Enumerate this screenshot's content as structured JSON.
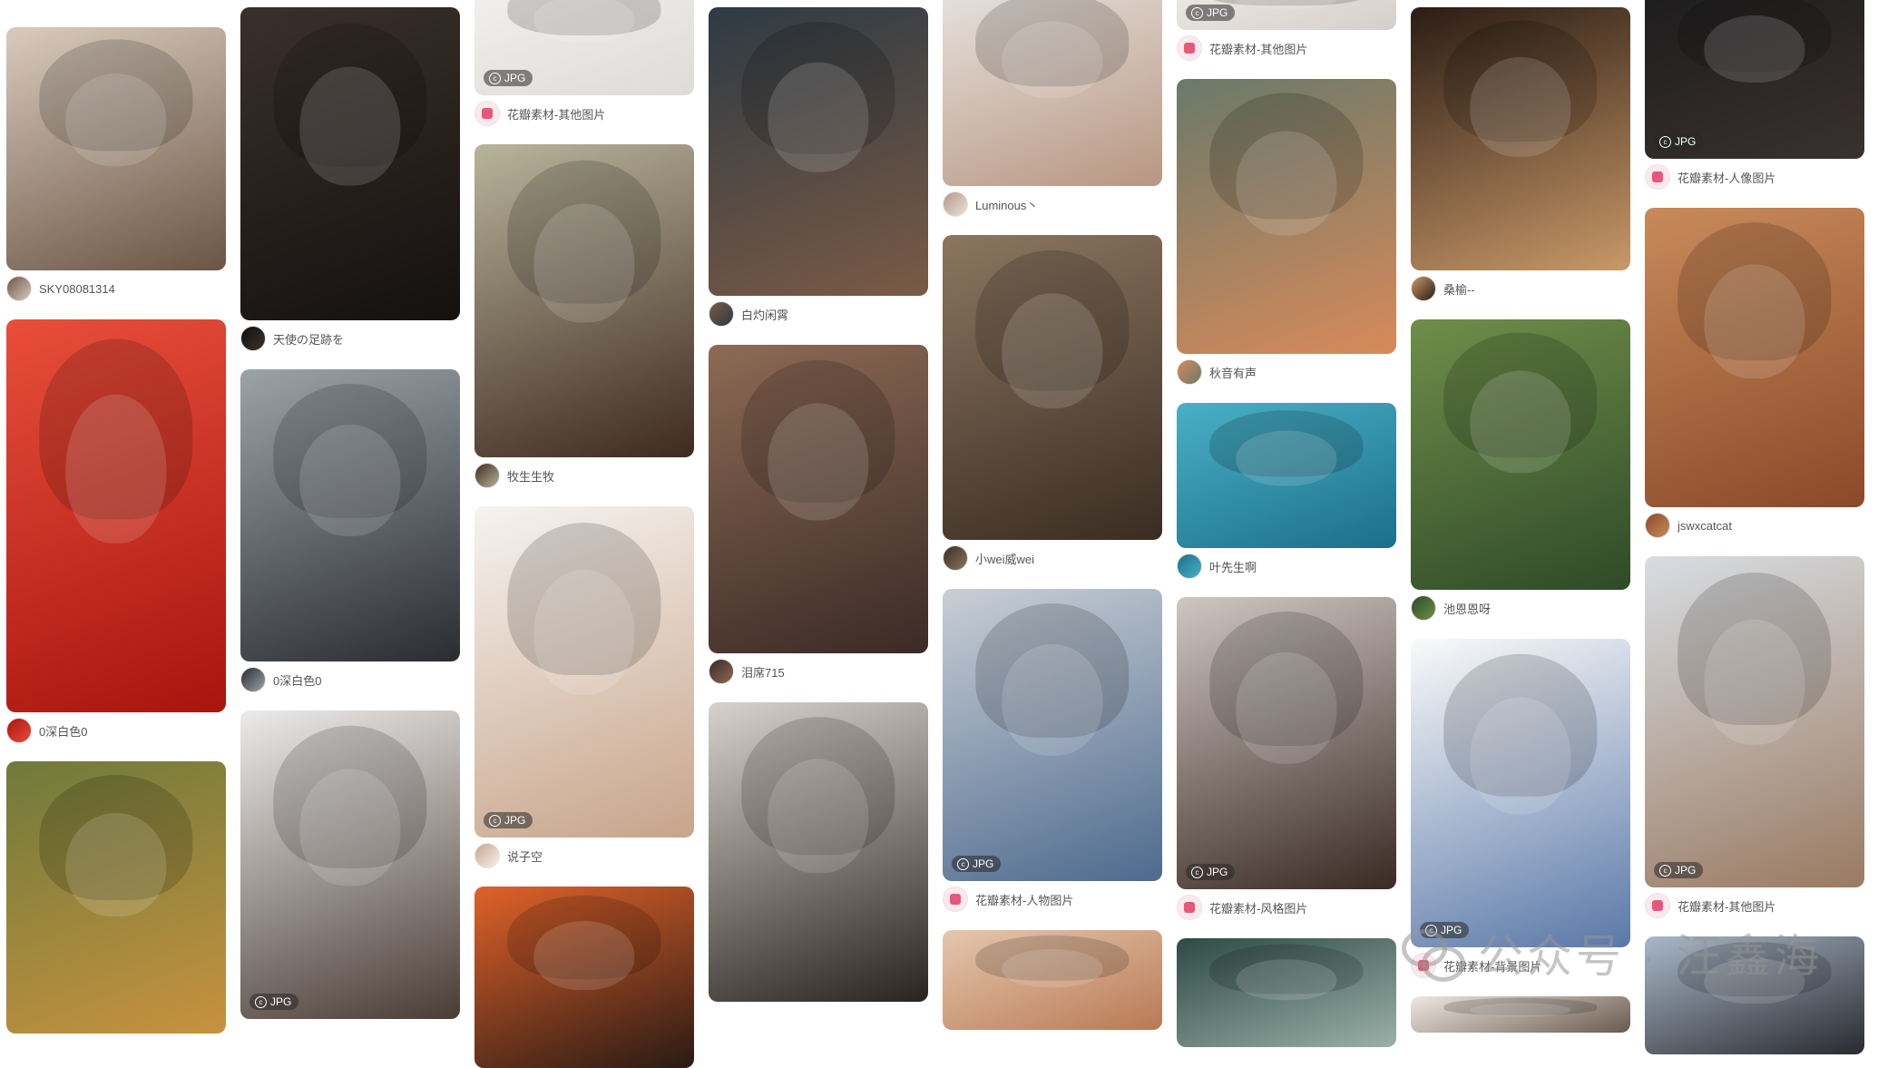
{
  "feed": {
    "columns": [
      {
        "pins": [
          {
            "author": "SKY08081314",
            "badge": "",
            "tone": [
              "#d9cbbd",
              "#6b5545"
            ]
          },
          {
            "author": "0深白色0",
            "badge": "",
            "tone": [
              "#e84e3a",
              "#a8140e"
            ]
          },
          {
            "author": "",
            "badge": "",
            "tone": [
              "#6f7a3a",
              "#c7923f"
            ]
          }
        ]
      },
      {
        "pins": [
          {
            "author": "天使の足跡を",
            "badge": "",
            "tone": [
              "#3a302b",
              "#14110f"
            ]
          },
          {
            "author": "0深白色0",
            "badge": "",
            "tone": [
              "#9ba3aa",
              "#2a2c30"
            ]
          },
          {
            "author": "",
            "badge": "JPG",
            "tone": [
              "#ecebea",
              "#4a3c35"
            ]
          }
        ]
      },
      {
        "pins": [
          {
            "author": "花瓣素材-其他图片",
            "badge": "JPG",
            "tone": [
              "#f3f2f0",
              "#dedbd8"
            ],
            "source": true
          },
          {
            "author": "牧生生牧",
            "badge": "",
            "tone": [
              "#b9b49c",
              "#3e2a1e"
            ]
          },
          {
            "author": "说子空",
            "badge": "JPG",
            "tone": [
              "#f6f3f0",
              "#c8a48a"
            ]
          },
          {
            "author": "",
            "badge": "",
            "tone": [
              "#e0622a",
              "#2a1a14"
            ]
          }
        ]
      },
      {
        "pins": [
          {
            "author": "白灼闲霄",
            "badge": "",
            "tone": [
              "#2e3a44",
              "#7a5a45"
            ]
          },
          {
            "author": "泪席715",
            "badge": "",
            "tone": [
              "#8d6a55",
              "#3a2a26"
            ]
          },
          {
            "author": "",
            "badge": "",
            "tone": [
              "#d8d2cc",
              "#2a2420"
            ]
          }
        ]
      },
      {
        "pins": [
          {
            "author": "Luminous丶",
            "badge": "",
            "tone": [
              "#e8e4e0",
              "#b89682"
            ]
          },
          {
            "author": "小wei威wei",
            "badge": "",
            "tone": [
              "#8c7660",
              "#3a2c22"
            ]
          },
          {
            "author": "花瓣素材-人物图片",
            "badge": "JPG",
            "tone": [
              "#c9cfd6",
              "#4e6a8e"
            ],
            "source": true
          },
          {
            "author": "",
            "badge": "",
            "tone": [
              "#e5c7ae",
              "#b97a55"
            ]
          }
        ]
      },
      {
        "pins": [
          {
            "author": "花瓣素材-其他图片",
            "badge": "JPG",
            "tone": [
              "#eeeae6",
              "#d6cfc9"
            ],
            "source": true
          },
          {
            "author": "秋音有声",
            "badge": "",
            "tone": [
              "#6a7a6a",
              "#d78a5a"
            ]
          },
          {
            "author": "叶先生啊",
            "badge": "",
            "tone": [
              "#49b0c6",
              "#1c6f8a"
            ]
          },
          {
            "author": "花瓣素材-风格图片",
            "badge": "JPG",
            "tone": [
              "#cfc6c2",
              "#3a2a24"
            ],
            "source": true
          },
          {
            "author": "",
            "badge": "",
            "tone": [
              "#2e4a44",
              "#9ab0a8"
            ]
          }
        ]
      },
      {
        "pins": [
          {
            "author": "桑榆--",
            "badge": "",
            "tone": [
              "#2a1c14",
              "#c99868"
            ]
          },
          {
            "author": "池恩恩呀",
            "badge": "",
            "tone": [
              "#6f8e4a",
              "#2e4a28"
            ]
          },
          {
            "author": "花瓣素材-背景图片",
            "badge": "JPG",
            "tone": [
              "#fafafa",
              "#5a78a8"
            ],
            "source": true
          },
          {
            "author": "",
            "badge": "",
            "tone": [
              "#efe8e2",
              "#6a5a4e"
            ]
          }
        ]
      },
      {
        "pins": [
          {
            "author": "花瓣素材-人像图片",
            "badge": "JPG",
            "tone": [
              "#1c1c1c",
              "#3a3030"
            ],
            "source": true
          },
          {
            "author": "jswxcatcat",
            "badge": "",
            "tone": [
              "#c98a5a",
              "#8a4a2a"
            ]
          },
          {
            "author": "花瓣素材-其他图片",
            "badge": "JPG",
            "tone": [
              "#d8dde2",
              "#9a7a62"
            ],
            "source": true
          },
          {
            "author": "",
            "badge": "",
            "tone": [
              "#a8b8c8",
              "#2a2a30"
            ]
          }
        ]
      }
    ]
  },
  "watermark": {
    "text": "公众号 · 汪鑫海",
    "icon": "wechat-icon"
  }
}
